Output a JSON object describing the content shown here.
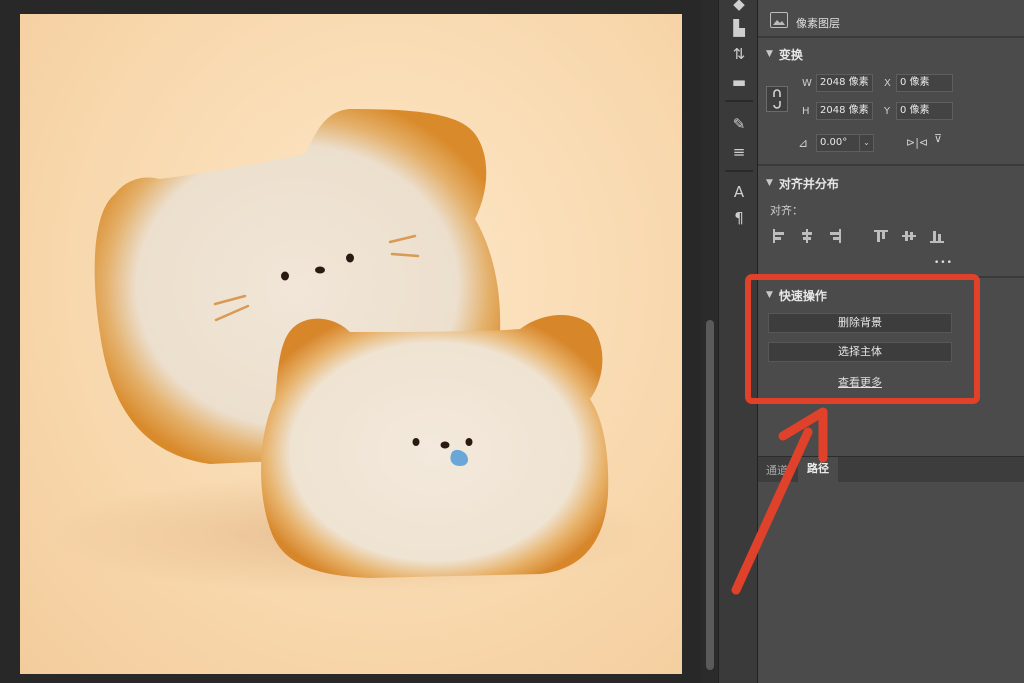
{
  "layer": {
    "label": "像素图层"
  },
  "transform": {
    "title": "变换",
    "w_label": "W",
    "w_value": "2048 像素",
    "h_label": "H",
    "h_value": "2048 像素",
    "x_label": "X",
    "x_value": "0 像素",
    "y_label": "Y",
    "y_value": "0 像素",
    "angle_value": "0.00°"
  },
  "align": {
    "title": "对齐并分布",
    "label": "对齐：",
    "more": "•••"
  },
  "quick_actions": {
    "title": "快速操作",
    "remove_bg": "删除背景",
    "select_subject": "选择主体",
    "see_more": "查看更多"
  },
  "tabs": {
    "channels": "通道",
    "paths": "路径"
  },
  "colors": {
    "annotation": "#e0412a",
    "canvas_bg": "#f9dcb4",
    "panel_bg": "#4b4b4b"
  }
}
